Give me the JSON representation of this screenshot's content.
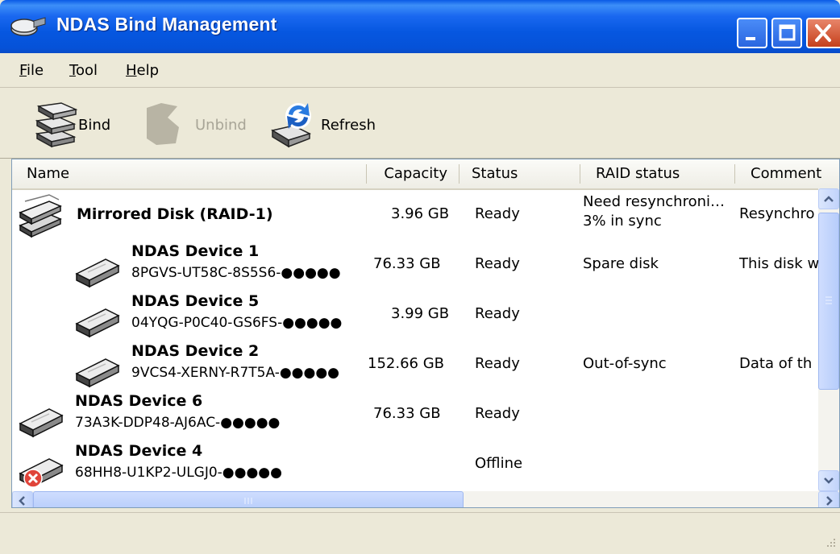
{
  "window": {
    "title": "NDAS Bind Management"
  },
  "menu": {
    "items": [
      "File",
      "Tool",
      "Help"
    ]
  },
  "toolbar": {
    "bind_label": "Bind",
    "unbind_label": "Unbind",
    "refresh_label": "Refresh",
    "unbind_enabled": false
  },
  "list": {
    "columns": [
      "Name",
      "Capacity",
      "Status",
      "RAID status",
      "Comment"
    ],
    "rows": [
      {
        "name": "Mirrored Disk (RAID-1)",
        "serial": "",
        "capacity": "3.96 GB",
        "status": "Ready",
        "raid_status_line1": "Need resynchroni…",
        "raid_status_line2": "3% in sync",
        "comment": "Resynchro",
        "indent": 0,
        "icon": "raid-disk-icon"
      },
      {
        "name": "NDAS Device 1",
        "serial": "8PGVS-UT58C-8S5S6-●●●●●",
        "capacity": "76.33 GB",
        "status": "Ready",
        "raid_status_line1": "Spare disk",
        "raid_status_line2": "",
        "comment": "This disk w",
        "indent": 1,
        "icon": "hard-disk-icon"
      },
      {
        "name": "NDAS Device 5",
        "serial": "04YQG-P0C40-GS6FS-●●●●●",
        "capacity": "3.99 GB",
        "status": "Ready",
        "raid_status_line1": "",
        "raid_status_line2": "",
        "comment": "",
        "indent": 1,
        "icon": "hard-disk-icon"
      },
      {
        "name": "NDAS Device 2",
        "serial": "9VCS4-XERNY-R7T5A-●●●●●",
        "capacity": "152.66 GB",
        "status": "Ready",
        "raid_status_line1": "Out-of-sync",
        "raid_status_line2": "",
        "comment": "Data of th",
        "indent": 1,
        "icon": "hard-disk-icon"
      },
      {
        "name": "NDAS Device 6",
        "serial": "73A3K-DDP48-AJ6AC-●●●●●",
        "capacity": "76.33 GB",
        "status": "Ready",
        "raid_status_line1": "",
        "raid_status_line2": "",
        "comment": "",
        "indent": 0,
        "icon": "hard-disk-icon"
      },
      {
        "name": "NDAS Device 4",
        "serial": "68HH8-U1KP2-ULGJ0-●●●●●",
        "capacity": "",
        "status": "Offline",
        "raid_status_line1": "",
        "raid_status_line2": "",
        "comment": "",
        "indent": 0,
        "icon": "offline-disk-icon"
      }
    ]
  },
  "colors": {
    "titlebar": "#0657e0",
    "selection": "#316ac5",
    "offline_badge": "#e0443a"
  }
}
